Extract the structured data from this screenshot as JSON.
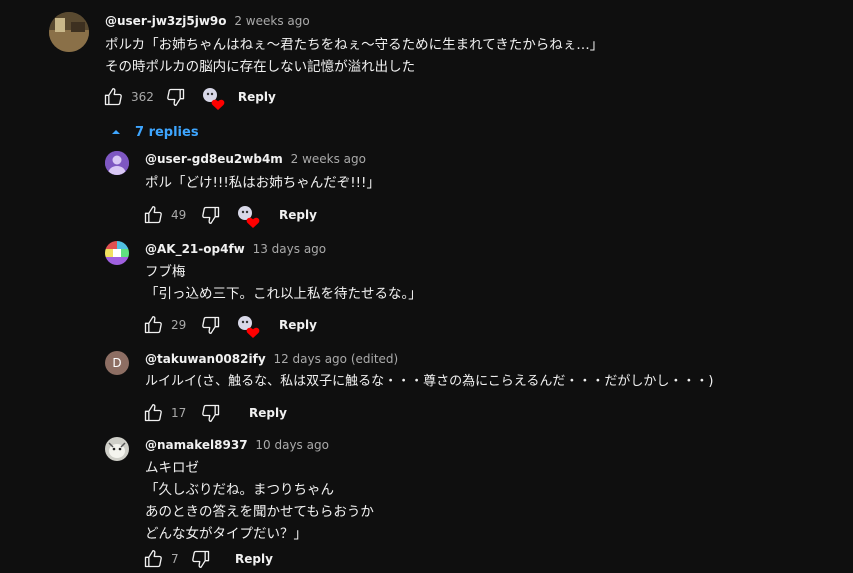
{
  "top_comment": {
    "author": "@user-jw3zj5jw9o",
    "time": "2 weeks ago",
    "lines": [
      "ポルカ「お姉ちゃんはねぇ〜君たちをねぇ〜守るために生まれてきたからねぇ…」",
      "その時ポルカの脳内に存在しない記憶が溢れ出した"
    ],
    "likes": "362",
    "reply_label": "Reply"
  },
  "replies_toggle": {
    "label": "7 replies"
  },
  "replies": [
    {
      "author": "@user-gd8eu2wb4m",
      "time": "2 weeks ago",
      "lines": [
        "ポル「どけ!!!私はお姉ちゃんだぞ!!!」"
      ],
      "likes": "49",
      "reply_label": "Reply",
      "avatar_letter": ""
    },
    {
      "author": "@AK_21-op4fw",
      "time": "13 days ago",
      "lines": [
        "フブ梅",
        "「引っ込め三下。これ以上私を待たせるな。」"
      ],
      "likes": "29",
      "reply_label": "Reply",
      "avatar_letter": ""
    },
    {
      "author": "@takuwan0082ify",
      "time": "12 days ago (edited)",
      "lines": [
        "ルイルイ(さ、触るな、私は双子に触るな・・・尊さの為にこらえるんだ・・・だがしかし・・・)"
      ],
      "likes": "17",
      "reply_label": "Reply",
      "avatar_letter": "D"
    },
    {
      "author": "@namakel8937",
      "time": "10 days ago",
      "lines": [
        "ムキロゼ",
        "「久しぶりだね。まつりちゃん",
        "あのときの答えを聞かせてもらおうか",
        "どんな女がタイプだい？」"
      ],
      "likes": "7",
      "reply_label": "Reply",
      "avatar_letter": ""
    }
  ],
  "colors": {
    "accent": "#3ea6ff",
    "heart": "#ff0000",
    "bg": "#0f0f0f",
    "muted": "#aaaaaa"
  },
  "icons": [
    "thumb-up-icon",
    "thumb-down-icon",
    "creator-heart-icon",
    "chevron-up-icon"
  ]
}
